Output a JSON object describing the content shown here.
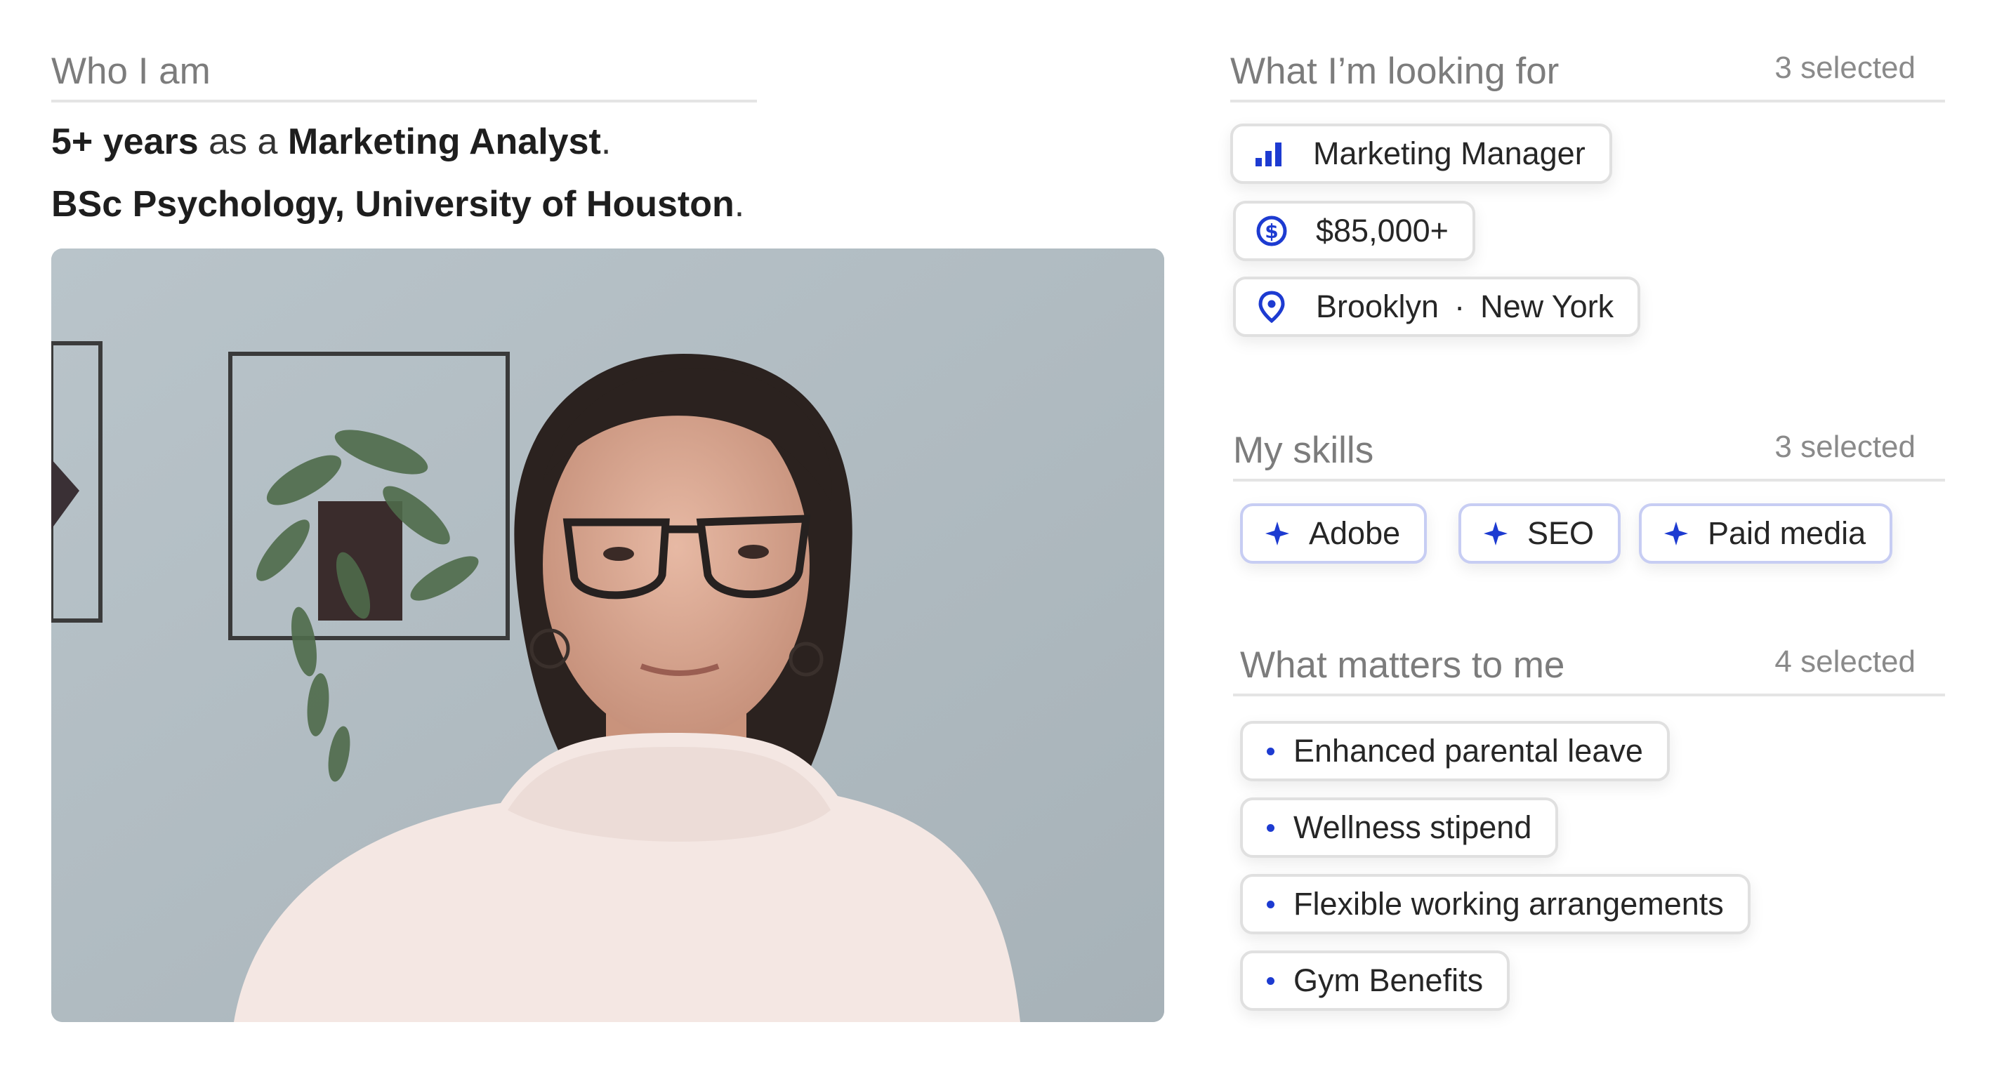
{
  "who": {
    "title": "Who I am",
    "exp_years": "5+ years",
    "exp_mid": "as a",
    "exp_role": "Marketing Analyst",
    "exp_end": ".",
    "education": "BSc Psychology, University of Houston",
    "education_end": "."
  },
  "looking": {
    "title": "What I’m looking for",
    "count": "3 selected",
    "role": "Marketing Manager",
    "salary": "$85,000+",
    "city": "Brooklyn",
    "separator": "·",
    "state": "New York"
  },
  "skills": {
    "title": "My skills",
    "count": "3 selected",
    "items": [
      "Adobe",
      "SEO",
      "Paid media"
    ]
  },
  "values": {
    "title": "What matters to me",
    "count": "4 selected",
    "items": [
      "Enhanced parental leave",
      "Wellness stipend",
      "Flexible working arrangements",
      "Gym Benefits"
    ]
  },
  "icons": {
    "role": "bar-chart-icon",
    "salary": "dollar-coin-icon",
    "location": "map-pin-icon",
    "skill": "sparkle-icon",
    "value": "bullet-dot-icon"
  },
  "colors": {
    "accent": "#1d3bd1",
    "skill_border": "#c7cdf3",
    "divider": "#e4e4e4"
  }
}
